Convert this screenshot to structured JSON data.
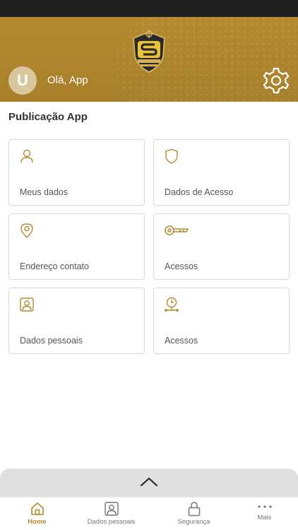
{
  "header": {
    "avatar_initial": "U",
    "greeting": "Olá, App"
  },
  "section_title": "Publicação App",
  "cards": [
    {
      "label": "Meus dados",
      "icon": "user-icon"
    },
    {
      "label": "Dados de Acesso",
      "icon": "shield-icon"
    },
    {
      "label": "Endereço contato",
      "icon": "location-pin-icon"
    },
    {
      "label": "Acessos",
      "icon": "key-icon"
    },
    {
      "label": "Dados pessoais",
      "icon": "id-badge-icon"
    },
    {
      "label": "Acessos",
      "icon": "clock-timeline-icon"
    }
  ],
  "tabs": [
    {
      "label": "Home",
      "icon": "home-icon",
      "active": true
    },
    {
      "label": "Dados pessoais",
      "icon": "id-badge-icon",
      "active": false
    },
    {
      "label": "Segurança",
      "icon": "lock-icon",
      "active": false
    },
    {
      "label": "Mais",
      "icon": "more-dots-icon",
      "active": false
    }
  ],
  "colors": {
    "brand": "#b58a2f",
    "card_border": "#d8d8d8",
    "header_bg": "#a8802c"
  }
}
